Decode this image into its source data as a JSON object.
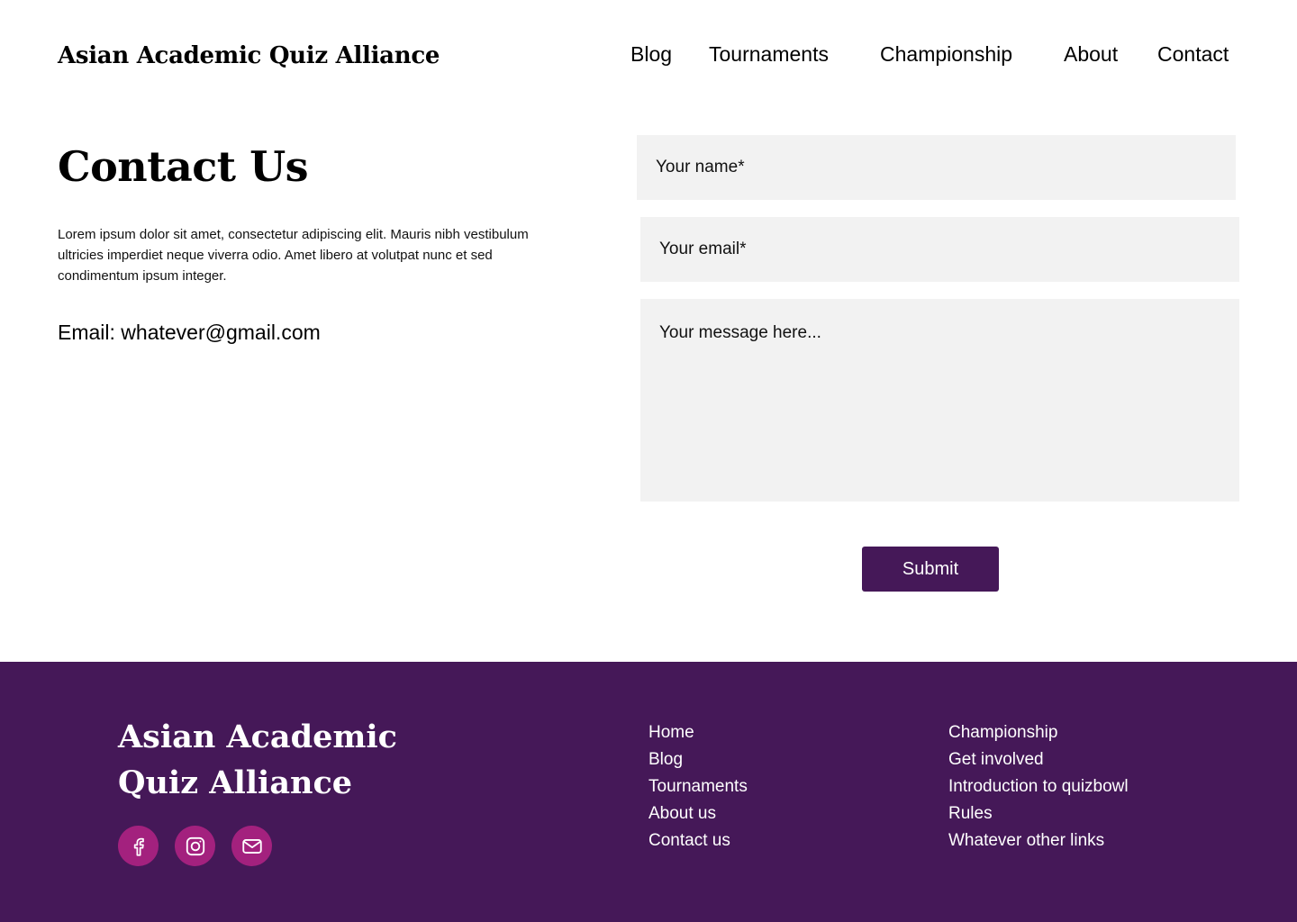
{
  "header": {
    "brand": "Asian Academic Quiz Alliance",
    "nav": [
      "Blog",
      "Tournaments",
      "Championship",
      "About",
      "Contact"
    ]
  },
  "contact": {
    "title": "Contact Us",
    "intro": "Lorem ipsum dolor sit amet, consectetur adipiscing elit. Mauris nibh vestibulum ultricies imperdiet neque viverra odio. Amet libero at volutpat nunc et sed condimentum ipsum integer.",
    "email_line": "Email: whatever@gmail.com"
  },
  "form": {
    "name_placeholder": "Your name*",
    "email_placeholder": "Your email*",
    "message_placeholder": "Your message here...",
    "submit_label": "Submit"
  },
  "footer": {
    "brand_line1": "Asian Academic",
    "brand_line2": "Quiz Alliance",
    "social_icons": [
      "facebook-icon",
      "instagram-icon",
      "email-icon"
    ],
    "links_col1": [
      "Home",
      "Blog",
      "Tournaments",
      "About us",
      "Contact us"
    ],
    "links_col2": [
      "Championship",
      "Get involved",
      "Introduction to quizbowl",
      "Rules",
      "Whatever other links"
    ]
  },
  "colors": {
    "brand_purple": "#451858",
    "social_magenta": "#a3217e",
    "field_gray": "#f2f2f2"
  }
}
